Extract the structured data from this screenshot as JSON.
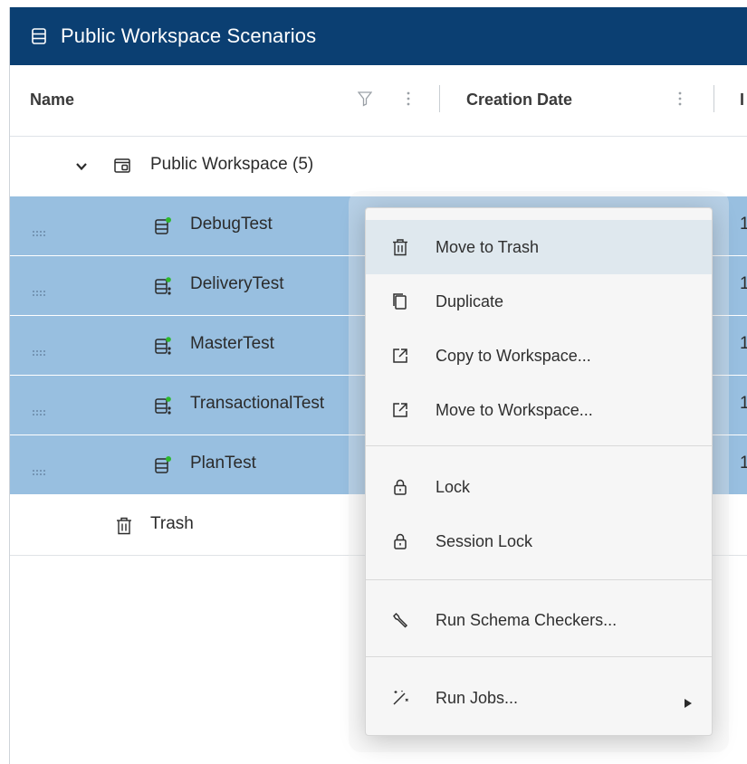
{
  "panel": {
    "title": "Public Workspace Scenarios",
    "title_icon": "database-icon"
  },
  "columns": {
    "name": "Name",
    "creation_date": "Creation Date",
    "third_partial": "I"
  },
  "tree": {
    "group_label": "Public Workspace (5)",
    "group_icon": "workspace-folder-icon",
    "scenarios": [
      {
        "label": "DebugTest",
        "icon": "scenario-database-icon",
        "selected": true
      },
      {
        "label": "DeliveryTest",
        "icon": "scenario-database-share-icon",
        "selected": true
      },
      {
        "label": "MasterTest",
        "icon": "scenario-database-share-icon",
        "selected": true
      },
      {
        "label": "TransactionalTest",
        "icon": "scenario-database-share-icon",
        "selected": true
      },
      {
        "label": "PlanTest",
        "icon": "scenario-database-icon",
        "selected": true
      }
    ],
    "trash_label": "Trash",
    "row_tail": "1"
  },
  "context_menu": {
    "items": [
      {
        "label": "Move to Trash",
        "icon": "trash-icon"
      },
      {
        "label": "Duplicate",
        "icon": "duplicate-icon"
      },
      {
        "label": "Copy to Workspace...",
        "icon": "external-link-icon"
      },
      {
        "label": "Move to Workspace...",
        "icon": "external-link-icon"
      },
      {
        "label": "Lock",
        "icon": "lock-icon"
      },
      {
        "label": "Session Lock",
        "icon": "lock-icon"
      },
      {
        "label": "Run Schema Checkers...",
        "icon": "wrench-icon"
      },
      {
        "label": "Run Jobs...",
        "icon": "magic-wand-icon"
      }
    ],
    "hovered": "Move to Trash"
  },
  "colors": {
    "titlebar": "#0b3f72",
    "selected_row": "#98bfe0",
    "menu_hover": "#dfe8ee",
    "icon_green": "#2eb82e"
  }
}
